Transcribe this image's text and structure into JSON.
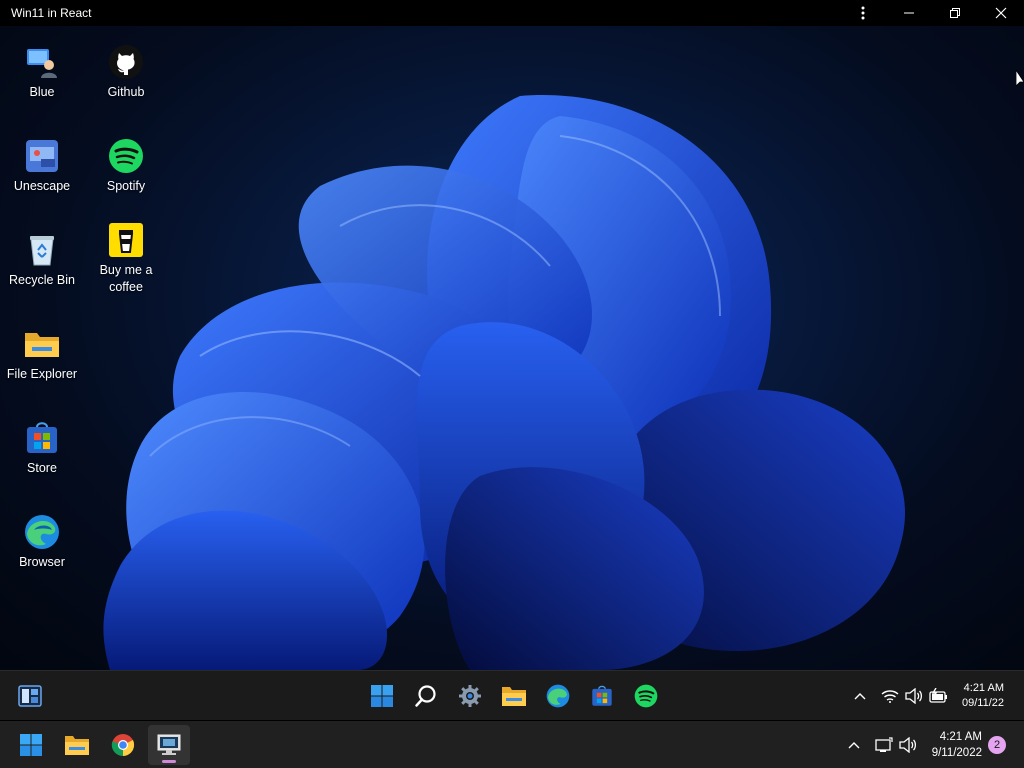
{
  "window": {
    "title": "Win11 in React"
  },
  "desktop_icons": [
    {
      "label": "Blue",
      "icon": "blue-user-icon"
    },
    {
      "label": "Unescape",
      "icon": "unescape-icon"
    },
    {
      "label": "Recycle Bin",
      "icon": "recycle-bin-icon"
    },
    {
      "label": "File Explorer",
      "icon": "folder-icon"
    },
    {
      "label": "Store",
      "icon": "store-icon"
    },
    {
      "label": "Browser",
      "icon": "edge-icon"
    },
    {
      "label": "Github",
      "icon": "github-icon"
    },
    {
      "label": "Spotify",
      "icon": "spotify-icon"
    },
    {
      "label": "Buy me a coffee",
      "icon": "coffee-icon"
    }
  ],
  "inner_taskbar": {
    "apps": [
      "start-icon",
      "search-icon",
      "settings-icon",
      "folder-icon",
      "edge-icon",
      "store-icon",
      "spotify-icon"
    ],
    "time": "4:21 AM",
    "date": "09/11/22"
  },
  "outer_taskbar": {
    "apps": [
      "start-icon",
      "folder-icon",
      "chrome-icon",
      "remote-desktop-icon"
    ],
    "time": "4:21 AM",
    "date": "9/11/2022",
    "notification_count": "2"
  },
  "colors": {
    "accent_blue": "#1f6fe5",
    "spotify_green": "#1ed760",
    "folder_yellow": "#f5c542",
    "coffee_yellow": "#ffdd00",
    "badge_pink": "#e4a4ef"
  }
}
